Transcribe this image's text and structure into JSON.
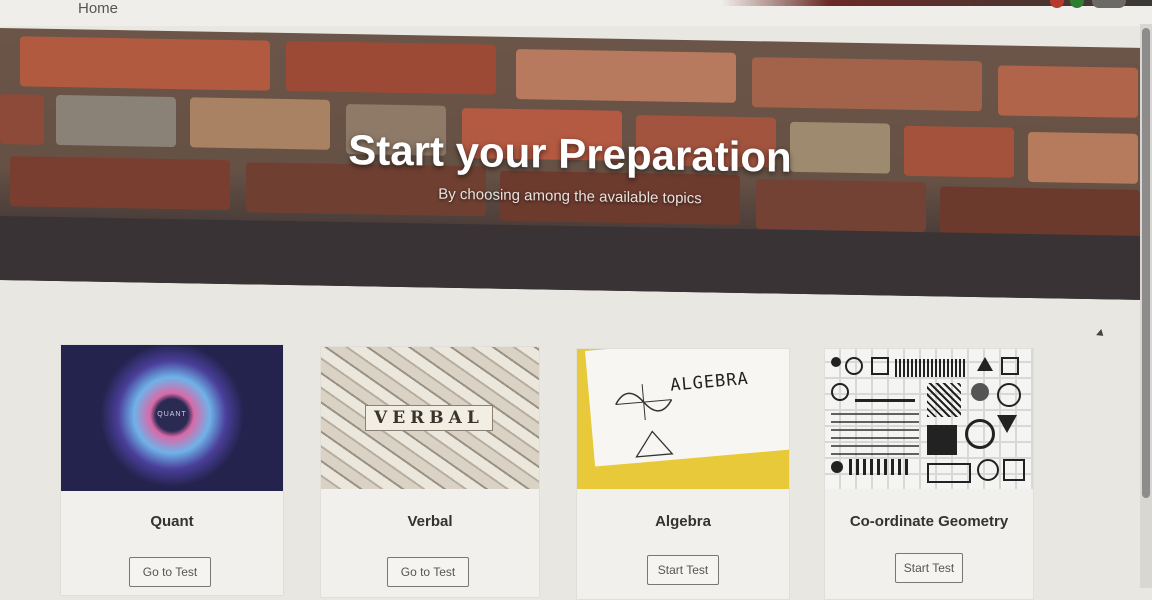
{
  "nav": {
    "home_label": "Home"
  },
  "hero": {
    "title": "Start your Preparation",
    "subtitle": "By choosing among the available topics"
  },
  "cards": [
    {
      "title": "Quant",
      "button_label": "Go to Test",
      "thumb_text": "QUANT"
    },
    {
      "title": "Verbal",
      "button_label": "Go to Test",
      "thumb_text": "VERBAL"
    },
    {
      "title": "Algebra",
      "button_label": "Start Test",
      "thumb_text": "ALGEBRA"
    },
    {
      "title": "Co-ordinate Geometry",
      "button_label": "Start Test"
    }
  ],
  "colors": {
    "hero_overlay": "#1e1e28",
    "brick": "#a8553f",
    "quant_bg": "#23234d",
    "algebra_bg": "#e8c93a"
  }
}
